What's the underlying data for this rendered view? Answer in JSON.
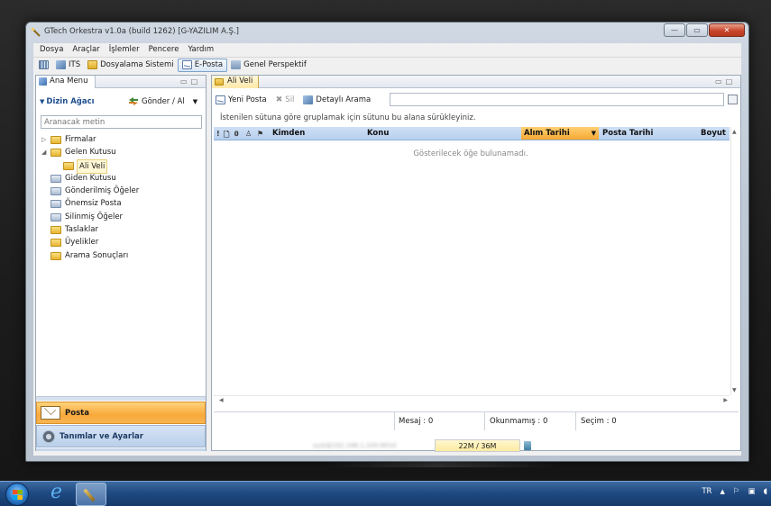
{
  "window": {
    "title": "GTech Orkestra v1.0a (build 1262) [G-YAZILIM A.Ş.]",
    "controls": {
      "minimize": "—",
      "maximize": "▭",
      "close": "✕"
    }
  },
  "menubar": [
    "Dosya",
    "Araçlar",
    "İşlemler",
    "Pencere",
    "Yardım"
  ],
  "toolbar": {
    "items": [
      {
        "label": "",
        "icon": "grid-icon"
      },
      {
        "label": "ITS",
        "icon": "its-icon"
      },
      {
        "label": "Dosyalama Sistemi",
        "icon": "folder-icon"
      },
      {
        "label": "E-Posta",
        "icon": "mail-icon",
        "active": true
      },
      {
        "label": "Genel Perspektif",
        "icon": "perspective-icon"
      }
    ]
  },
  "left_panel": {
    "tab": "Ana Menu",
    "section_title": "Dizin Ağacı",
    "send_receive": "Gönder / Al",
    "search_placeholder": "Aranacak metin",
    "tree": [
      {
        "label": "Firmalar",
        "level": 1,
        "expander": "▷",
        "type": "folder"
      },
      {
        "label": "Gelen Kutusu",
        "level": 1,
        "expander": "◢",
        "type": "folder"
      },
      {
        "label": "Ali Veli",
        "level": 2,
        "expander": "",
        "type": "folder",
        "selected": true
      },
      {
        "label": "Giden Kutusu",
        "level": 1,
        "expander": "",
        "type": "special"
      },
      {
        "label": "Gönderilmiş Öğeler",
        "level": 1,
        "expander": "",
        "type": "special"
      },
      {
        "label": "Önemsiz Posta",
        "level": 1,
        "expander": "",
        "type": "special"
      },
      {
        "label": "Silinmiş Öğeler",
        "level": 1,
        "expander": "",
        "type": "special"
      },
      {
        "label": "Taslaklar",
        "level": 1,
        "expander": "",
        "type": "folder"
      },
      {
        "label": "Üyelikler",
        "level": 1,
        "expander": "",
        "type": "folder"
      },
      {
        "label": "Arama Sonuçları",
        "level": 1,
        "expander": "",
        "type": "folder"
      }
    ],
    "nav_posta": "Posta",
    "nav_settings": "Tanımlar ve Ayarlar"
  },
  "right_panel": {
    "tab": "Ali Veli",
    "buttons": {
      "new_mail": "Yeni Posta",
      "delete": "Sil",
      "detailed_search": "Detaylı Arama"
    },
    "group_hint": "İstenilen sütuna göre gruplamak için sütunu bu alana sürükleyiniz.",
    "columns": {
      "flag": "!",
      "from": "Kimden",
      "subject": "Konu",
      "received": "Alım Tarihi",
      "sent": "Posta Tarihi",
      "size": "Boyut"
    },
    "empty_message": "Gösterilecek öğe bulunamadı.",
    "status": {
      "messages": "Mesaj : 0",
      "unread": "Okunmamış : 0",
      "selection": "Seçim : 0"
    }
  },
  "bottom_status": {
    "user": "syst@192.168.1.200:8010",
    "memory": "22M / 36M"
  },
  "taskbar": {
    "language": "TR",
    "tray_icons": [
      "flag-icon",
      "network-icon",
      "volume-icon"
    ]
  }
}
